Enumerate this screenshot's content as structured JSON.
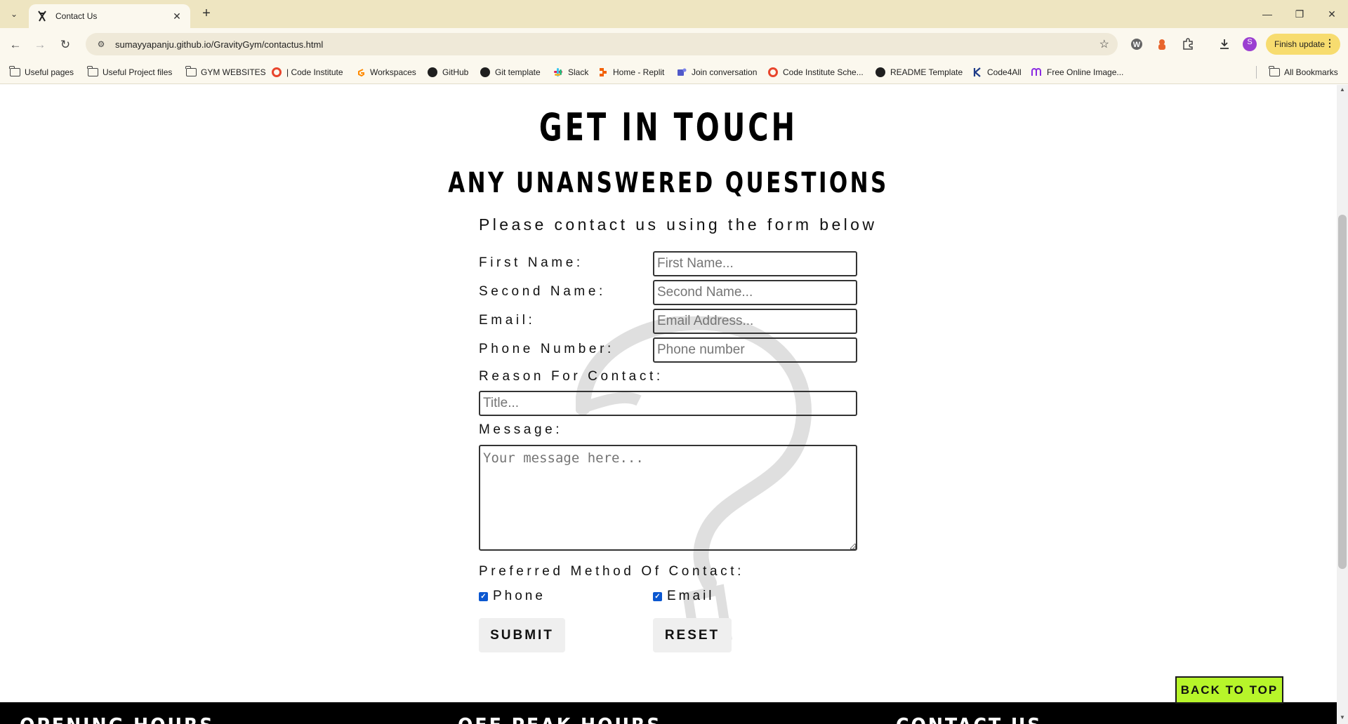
{
  "browser": {
    "tab_title": "Contact Us",
    "url": "sumayyapanju.github.io/GravityGym/contactus.html",
    "finish_update": "Finish update",
    "profile_initial": "S",
    "bookmarks": [
      "Useful pages",
      "Useful Project files",
      "GYM WEBSITES",
      "| Code Institute",
      "Workspaces",
      "GitHub",
      "Git template",
      "Slack",
      "Home - Replit",
      "Join conversation",
      "Code Institute Sche...",
      "README Template",
      "Code4All",
      "Free Online Image..."
    ],
    "all_bookmarks": "All Bookmarks"
  },
  "page": {
    "heading": "GET IN TOUCH",
    "subheading": "ANY UNANSWERED QUESTIONS",
    "lead": "Please contact us using the form below",
    "form": {
      "first_name_label": "First Name:",
      "first_name_placeholder": "First Name...",
      "second_name_label": "Second Name:",
      "second_name_placeholder": "Second Name...",
      "email_label": "Email:",
      "email_placeholder": "Email Address...",
      "phone_label": "Phone Number:",
      "phone_placeholder": "Phone number",
      "reason_label": "Reason For Contact:",
      "reason_placeholder": "Title...",
      "message_label": "Message:",
      "message_placeholder": "Your message here...",
      "preferred_label": "Preferred Method Of Contact:",
      "option_phone": "Phone",
      "option_phone_checked": true,
      "option_email": "Email",
      "option_email_checked": true,
      "submit": "SUBMIT",
      "reset": "RESET"
    },
    "back_to_top": "BACK TO TOP",
    "footer": {
      "col1": "OPENING HOURS",
      "col2": "OFF PEAK HOURS",
      "col3": "CONTACT US"
    }
  },
  "colors": {
    "back_to_top_bg": "#b7f52a",
    "checkbox": "#0b57d0",
    "tabstrip": "#eee5c1",
    "footer_bg": "#000000"
  }
}
